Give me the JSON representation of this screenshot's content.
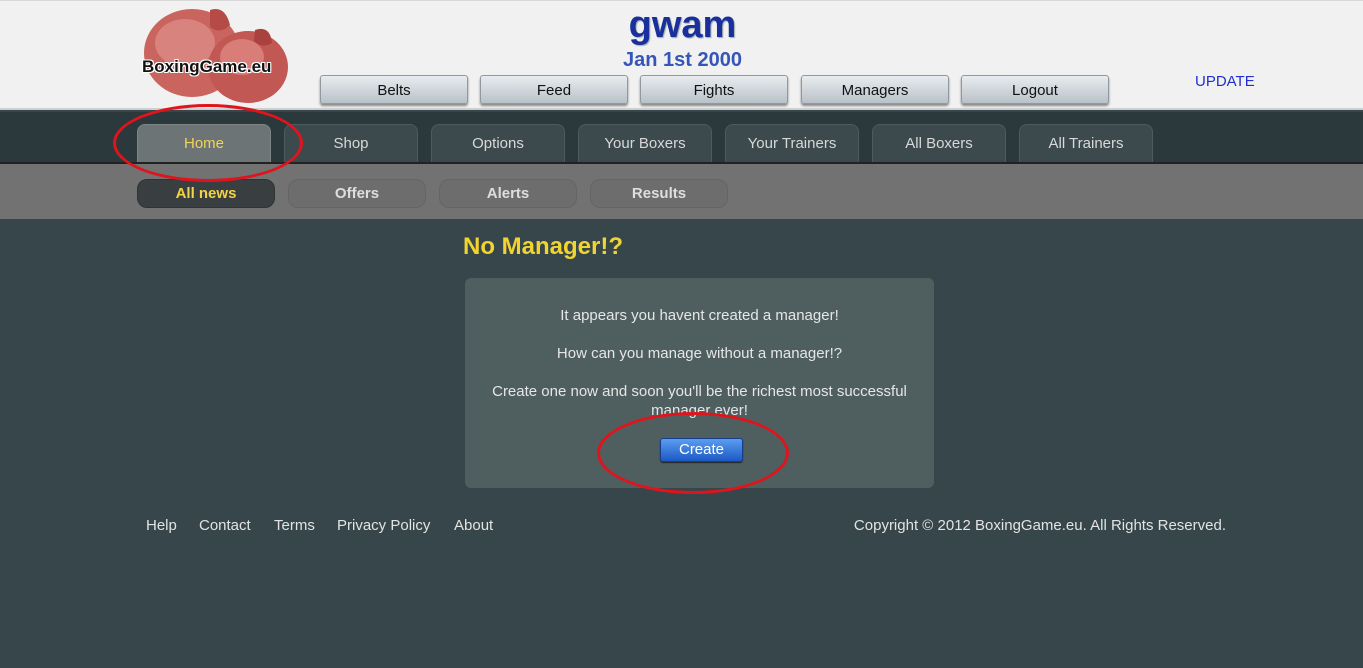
{
  "header": {
    "logo_text": "BoxingGame.eu",
    "user_name": "gwam",
    "game_date": "Jan 1st 2000",
    "update_label": "UPDATE",
    "top_nav": [
      "Belts",
      "Feed",
      "Fights",
      "Managers",
      "Logout"
    ]
  },
  "main_nav": {
    "tabs": [
      "Home",
      "Shop",
      "Options",
      "Your Boxers",
      "Your Trainers",
      "All Boxers",
      "All Trainers"
    ],
    "active": "Home"
  },
  "sub_nav": {
    "tabs": [
      "All news",
      "Offers",
      "Alerts",
      "Results"
    ],
    "active": "All news"
  },
  "content": {
    "title": "No Manager!?",
    "line1": "It appears you havent created a manager!",
    "line2": "How can you manage without a manager!?",
    "line3": "Create one now and soon you'll be the richest most successful manager ever!",
    "create_label": "Create"
  },
  "footer": {
    "links": [
      "Help",
      "Contact",
      "Terms",
      "Privacy Policy",
      "About"
    ],
    "copyright": "Copyright © 2012 BoxingGame.eu. All Rights Reserved."
  },
  "colors": {
    "accent_yellow": "#f2d42f",
    "page_bg": "#37464a",
    "annotation_red": "#e0141c",
    "button_blue": "#1c58c4"
  }
}
